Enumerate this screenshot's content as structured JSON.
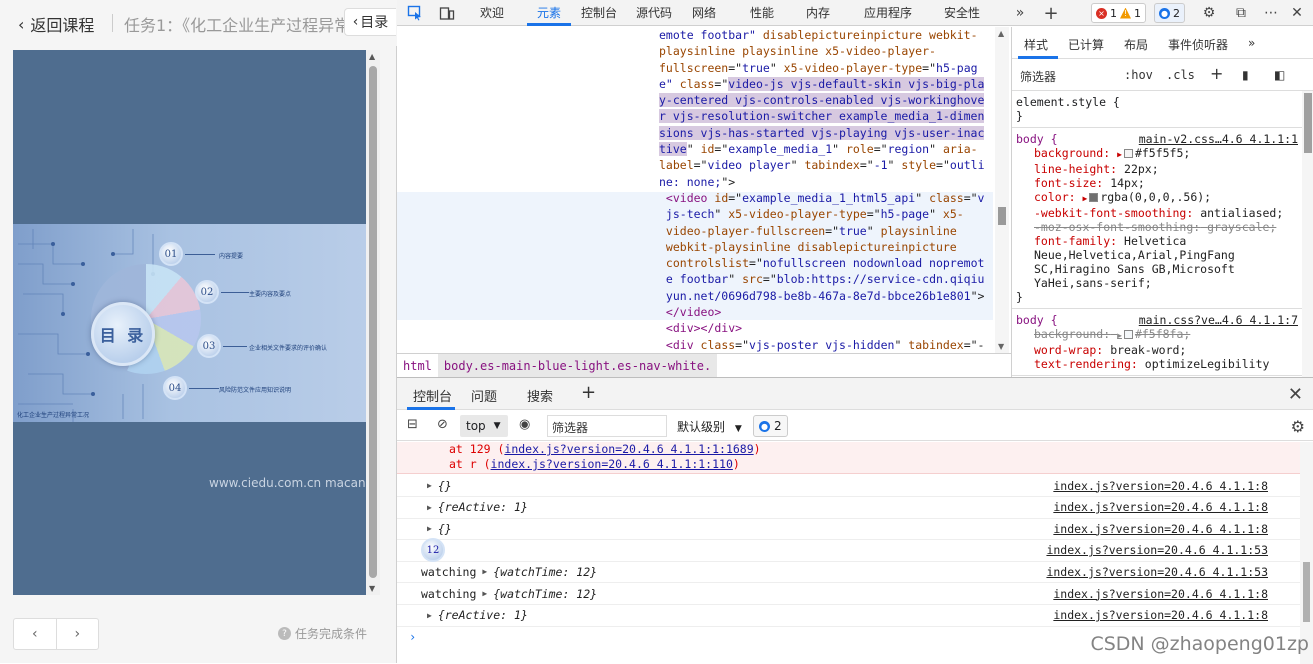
{
  "course": {
    "back_label": "返回课程",
    "task_title": "任务1：《化工企业生产过程异常",
    "toc_label": "目录",
    "slide": {
      "center_label": "目 录",
      "items": [
        {
          "num": "01",
          "text": "内容提要"
        },
        {
          "num": "02",
          "text": "主要内容及要点"
        },
        {
          "num": "03",
          "text": "企业相关文件要求的评价确认"
        },
        {
          "num": "04",
          "text": "风险防范文件应用知识说明"
        }
      ],
      "footer": "化工企业生产过程异常工况"
    },
    "watermark": "www.ciedu.com.cn macancn",
    "task_condition": "任务完成条件"
  },
  "devtools": {
    "tabs": [
      "欢迎",
      "元素",
      "控制台",
      "源代码",
      "网络",
      "性能",
      "内存",
      "应用程序",
      "安全性"
    ],
    "active_tab": "元素",
    "errors": "1",
    "warnings": "1",
    "issues": "2",
    "elements_lines": [
      [
        {
          "t": "val",
          "s": "emote footbar\" "
        },
        {
          "t": "attr",
          "s": "disablepictureinpicture webkit-"
        }
      ],
      [
        {
          "t": "attr",
          "s": "playsinline playsinline x5-video-player-"
        }
      ],
      [
        {
          "t": "attr",
          "s": "fullscreen"
        },
        {
          "t": "txt",
          "s": "=\""
        },
        {
          "t": "val",
          "s": "true"
        },
        {
          "t": "txt",
          "s": "\" "
        },
        {
          "t": "attr",
          "s": "x5-video-player-type"
        },
        {
          "t": "txt",
          "s": "=\""
        },
        {
          "t": "val",
          "s": "h5-pag"
        }
      ],
      [
        {
          "t": "val",
          "s": "e\" "
        },
        {
          "t": "attr",
          "s": "class"
        },
        {
          "t": "txt",
          "s": "=\""
        },
        {
          "t": "hl",
          "s": "video-js vjs-default-skin vjs-big-pla"
        }
      ],
      [
        {
          "t": "hl",
          "s": "y-centered vjs-controls-enabled vjs-workinghove"
        }
      ],
      [
        {
          "t": "hl",
          "s": "r vjs-resolution-switcher example_media_1-dimen"
        }
      ],
      [
        {
          "t": "hl",
          "s": "sions vjs-has-started vjs-playing vjs-user-inac"
        }
      ],
      [
        {
          "t": "hl",
          "s": "tive"
        },
        {
          "t": "txt",
          "s": "\" "
        },
        {
          "t": "attr",
          "s": "id"
        },
        {
          "t": "txt",
          "s": "=\""
        },
        {
          "t": "val",
          "s": "example_media_1"
        },
        {
          "t": "txt",
          "s": "\" "
        },
        {
          "t": "attr",
          "s": "role"
        },
        {
          "t": "txt",
          "s": "=\""
        },
        {
          "t": "val",
          "s": "region"
        },
        {
          "t": "txt",
          "s": "\" "
        },
        {
          "t": "attr",
          "s": "aria-"
        }
      ],
      [
        {
          "t": "attr",
          "s": "label"
        },
        {
          "t": "txt",
          "s": "=\""
        },
        {
          "t": "val",
          "s": "video player"
        },
        {
          "t": "txt",
          "s": "\" "
        },
        {
          "t": "attr",
          "s": "tabindex"
        },
        {
          "t": "txt",
          "s": "=\""
        },
        {
          "t": "val",
          "s": "-1"
        },
        {
          "t": "txt",
          "s": "\" "
        },
        {
          "t": "attr",
          "s": "style"
        },
        {
          "t": "txt",
          "s": "=\""
        },
        {
          "t": "val",
          "s": "outli"
        }
      ],
      [
        {
          "t": "val",
          "s": "ne: none;"
        },
        {
          "t": "txt",
          "s": "\">"
        }
      ],
      [
        {
          "t": "tag",
          "s": " <video "
        },
        {
          "t": "attr",
          "s": "id"
        },
        {
          "t": "txt",
          "s": "=\""
        },
        {
          "t": "val",
          "s": "example_media_1_html5_api"
        },
        {
          "t": "txt",
          "s": "\" "
        },
        {
          "t": "attr",
          "s": "class"
        },
        {
          "t": "txt",
          "s": "=\""
        },
        {
          "t": "val",
          "s": "v"
        }
      ],
      [
        {
          "t": "val",
          "s": " js-tech"
        },
        {
          "t": "txt",
          "s": "\" "
        },
        {
          "t": "attr",
          "s": "x5-video-player-type"
        },
        {
          "t": "txt",
          "s": "=\""
        },
        {
          "t": "val",
          "s": "h5-page"
        },
        {
          "t": "txt",
          "s": "\" "
        },
        {
          "t": "attr",
          "s": "x5-"
        }
      ],
      [
        {
          "t": "attr",
          "s": " video-player-fullscreen"
        },
        {
          "t": "txt",
          "s": "=\""
        },
        {
          "t": "val",
          "s": "true"
        },
        {
          "t": "txt",
          "s": "\" "
        },
        {
          "t": "attr",
          "s": "playsinline"
        }
      ],
      [
        {
          "t": "attr",
          "s": " webkit-playsinline disablepictureinpicture"
        }
      ],
      [
        {
          "t": "attr",
          "s": " controlslist"
        },
        {
          "t": "txt",
          "s": "=\""
        },
        {
          "t": "val",
          "s": "nofullscreen nodownload nopremot"
        }
      ],
      [
        {
          "t": "val",
          "s": " e footbar"
        },
        {
          "t": "txt",
          "s": "\" "
        },
        {
          "t": "attr",
          "s": "src"
        },
        {
          "t": "txt",
          "s": "=\""
        },
        {
          "t": "val",
          "s": "blob:https://service-cdn.qiqiu"
        }
      ],
      [
        {
          "t": "val",
          "s": " yun.net/0696d798-be8b-467a-8e7d-bbce26b1e801"
        },
        {
          "t": "txt",
          "s": "\">"
        }
      ],
      [
        {
          "t": "tag",
          "s": " </video>"
        }
      ],
      [
        {
          "t": "tag",
          "s": " <div></div>"
        }
      ],
      [
        {
          "t": "tag",
          "s": " <div "
        },
        {
          "t": "attr",
          "s": "class"
        },
        {
          "t": "txt",
          "s": "=\""
        },
        {
          "t": "val",
          "s": "vjs-poster vjs-hidden"
        },
        {
          "t": "txt",
          "s": "\" "
        },
        {
          "t": "attr",
          "s": "tabindex"
        },
        {
          "t": "txt",
          "s": "=\"-"
        }
      ]
    ],
    "breadcrumbs": {
      "html": "html",
      "body": "body.es-main-blue-light.es-nav-white."
    },
    "styles": {
      "tabs": [
        "样式",
        "已计算",
        "布局",
        "事件侦听器"
      ],
      "filter_placeholder": "筛选器",
      "hov": ":hov",
      "cls": ".cls",
      "element_style": "element.style {",
      "close_brace": "}",
      "rule1": {
        "selector": "body {",
        "source": "main-v2.css…4.6 4.1.1:1",
        "props": [
          {
            "n": "background:",
            "v": "#f5f5f5;",
            "swatch": "#f5f5f5"
          },
          {
            "n": "line-height:",
            "v": "22px;"
          },
          {
            "n": "font-size:",
            "v": "14px;"
          },
          {
            "n": "color:",
            "v": "rgba(0,0,0,.56);",
            "swatch": "#707070"
          },
          {
            "n": "-webkit-font-smoothing:",
            "v": "antialiased;"
          },
          {
            "n": "-moz-osx-font-smoothing:",
            "v": "grayscale;",
            "strike": true
          },
          {
            "n": "font-family:",
            "v": "Helvetica"
          },
          {
            "n": "",
            "v": "Neue,Helvetica,Arial,PingFang"
          },
          {
            "n": "",
            "v": "SC,Hiragino Sans GB,Microsoft"
          },
          {
            "n": "",
            "v": "YaHei,sans-serif;"
          }
        ]
      },
      "rule2": {
        "selector": "body {",
        "source": "main.css?ve…4.6 4.1.1:7",
        "props": [
          {
            "n": "background:",
            "v": "#f5f8fa;",
            "strike": true,
            "swatch": "#f5f8fa"
          },
          {
            "n": "word-wrap:",
            "v": "break-word;"
          },
          {
            "n": "text-rendering:",
            "v": "optimizeLegibility"
          }
        ]
      }
    },
    "drawer": {
      "tabs": [
        "控制台",
        "问题",
        "搜索"
      ],
      "context": "top",
      "filter_placeholder": "筛选器",
      "level": "默认级别",
      "issues": "2"
    },
    "console": {
      "error_lines": [
        {
          "pre": "at 129 (",
          "link": "index.js?version=20.4.6 4.1.1:1:1689",
          "post": ")"
        },
        {
          "pre": "at r (",
          "link": "index.js?version=20.4.6 4.1.1:1:110",
          "post": ")"
        }
      ],
      "rows": [
        {
          "prefix": "",
          "expand": true,
          "obj": "{}",
          "src": "index.js?version=20.4.6 4.1.1:8"
        },
        {
          "prefix": "",
          "expand": true,
          "obj": "{reActive: 1}",
          "src": "index.js?version=20.4.6 4.1.1:8"
        },
        {
          "prefix": "",
          "expand": true,
          "obj": "{}",
          "src": "index.js?version=20.4.6 4.1.1:8"
        },
        {
          "prefix": "12",
          "expand": false,
          "obj": "",
          "src": "index.js?version=20.4.6 4.1.1:53"
        },
        {
          "prefix": "watching",
          "expand": true,
          "obj": "{watchTime: 12}",
          "src": "index.js?version=20.4.6 4.1.1:53"
        },
        {
          "prefix": "watching",
          "expand": true,
          "obj": "{watchTime: 12}",
          "src": "index.js?version=20.4.6 4.1.1:8"
        },
        {
          "prefix": "",
          "expand": true,
          "obj": "{reActive: 1}",
          "src": "index.js?version=20.4.6 4.1.1:8"
        }
      ],
      "prompt": "›"
    }
  },
  "csdn_watermark": "CSDN @zhaopeng01zp"
}
